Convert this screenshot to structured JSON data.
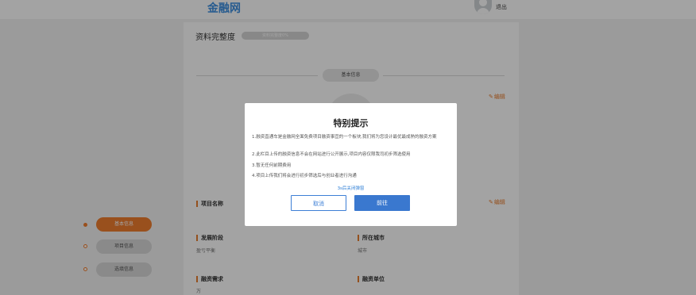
{
  "header": {
    "logo_text": "金融网",
    "logout_label": "退出"
  },
  "profile": {
    "completeness_label": "资料完整度",
    "completeness_value": "资料完整度0%",
    "completeness_fraction": 0
  },
  "sections": {
    "basic_info_title": "基本信息",
    "edit_label": "编辑",
    "edit_label_2": "编辑"
  },
  "fields": [
    {
      "label": "项目名称",
      "value": ""
    },
    {
      "label": "发展阶段",
      "value": "盈亏平衡"
    },
    {
      "label": "所在城市",
      "value": "城市"
    },
    {
      "label": "融资需求",
      "value": "万"
    },
    {
      "label": "融资单位",
      "value": ""
    }
  ],
  "sidenav": {
    "items": [
      {
        "label": "基本信息",
        "active": true
      },
      {
        "label": "项目信息",
        "active": false
      },
      {
        "label": "选填信息",
        "active": false
      }
    ]
  },
  "modal": {
    "title": "特别提示",
    "lines": [
      "1.融资直通车是金融网全面免费项目融资事宜的一个板块,我们将为您设计最优最成熟的融资方案",
      "2.此栏目上传的融资信息不会在网站进行公开展示,项目内容仅限我司初步筛选使用",
      "3.暂无任何前期费用",
      "4.项目上传我们将会进行初步筛选后与创业者进行沟通"
    ],
    "countdown": "3s后关闭弹窗",
    "cancel_label": "取消",
    "confirm_label": "前往"
  },
  "colors": {
    "accent_orange": "#f07d2e",
    "primary_blue": "#3a78cf",
    "logo_blue": "#3d8fe0"
  }
}
